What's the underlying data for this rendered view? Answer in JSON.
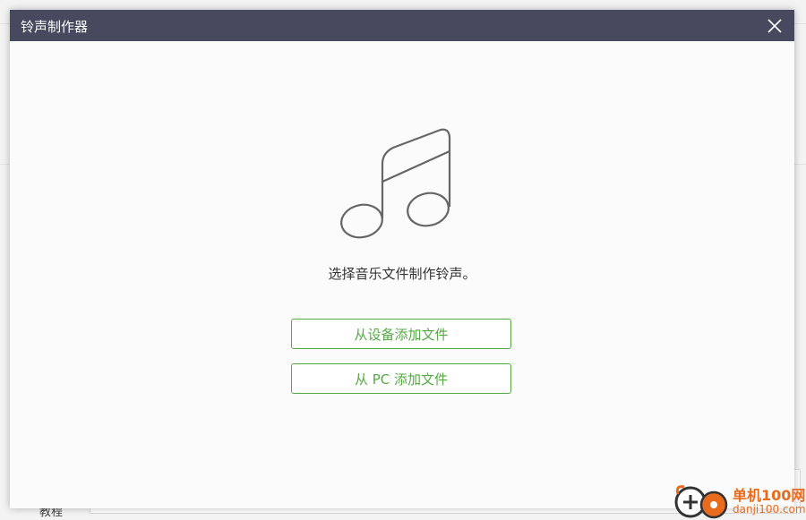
{
  "background": {
    "tutorial_label": "教程"
  },
  "dialog": {
    "title": "铃声制作器",
    "prompt": "选择音乐文件制作铃声。",
    "add_from_device_label": "从设备添加文件",
    "add_from_pc_label": "从 PC 添加文件",
    "icon": "music-note-icon",
    "close_icon": "close-icon"
  },
  "watermark": {
    "name": "单机100网",
    "url": "danji100.com"
  },
  "colors": {
    "titlebar": "#474a5e",
    "accent_green": "#56a845",
    "watermark_orange": "#e96b1d"
  }
}
